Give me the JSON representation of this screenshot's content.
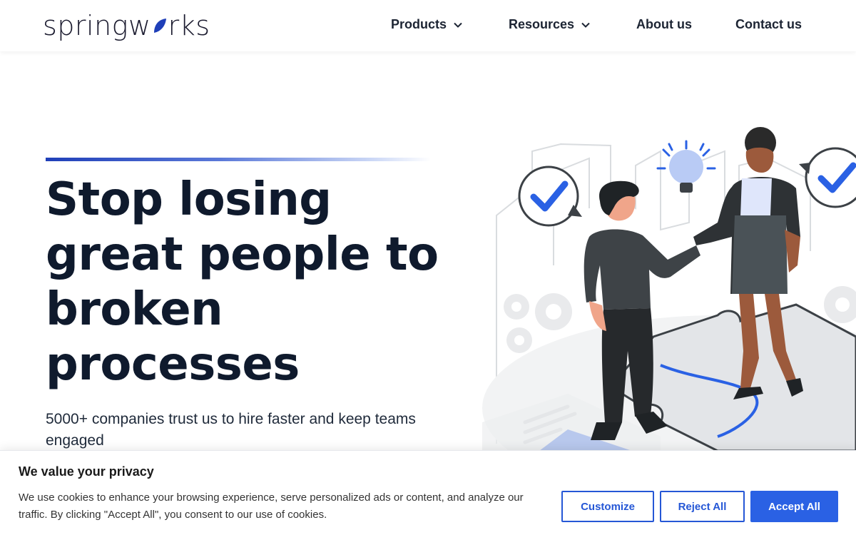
{
  "header": {
    "logo_text_left": "spring",
    "logo_text_right": "rks",
    "nav": [
      {
        "label": "Products",
        "has_dropdown": true
      },
      {
        "label": "Resources",
        "has_dropdown": true
      },
      {
        "label": "About us",
        "has_dropdown": false
      },
      {
        "label": "Contact us",
        "has_dropdown": false
      }
    ]
  },
  "hero": {
    "title_lines": [
      "Stop losing",
      "great people to",
      "broken",
      "processes"
    ],
    "subtitle": "5000+ companies trust us to hire faster and keep teams engaged",
    "illustration_icon": "handshake-illustration"
  },
  "cookie_banner": {
    "title": "We value your privacy",
    "text": "We use cookies to enhance your browsing experience, serve personalized ads or content, and analyze our traffic. By clicking \"Accept All\", you consent to our use of cookies.",
    "customize_label": "Customize",
    "reject_label": "Reject All",
    "accept_label": "Accept All"
  },
  "colors": {
    "brand_blue": "#2a61e4",
    "heading": "#0f1a2d",
    "logo_leaf": "#1f3fb8"
  }
}
